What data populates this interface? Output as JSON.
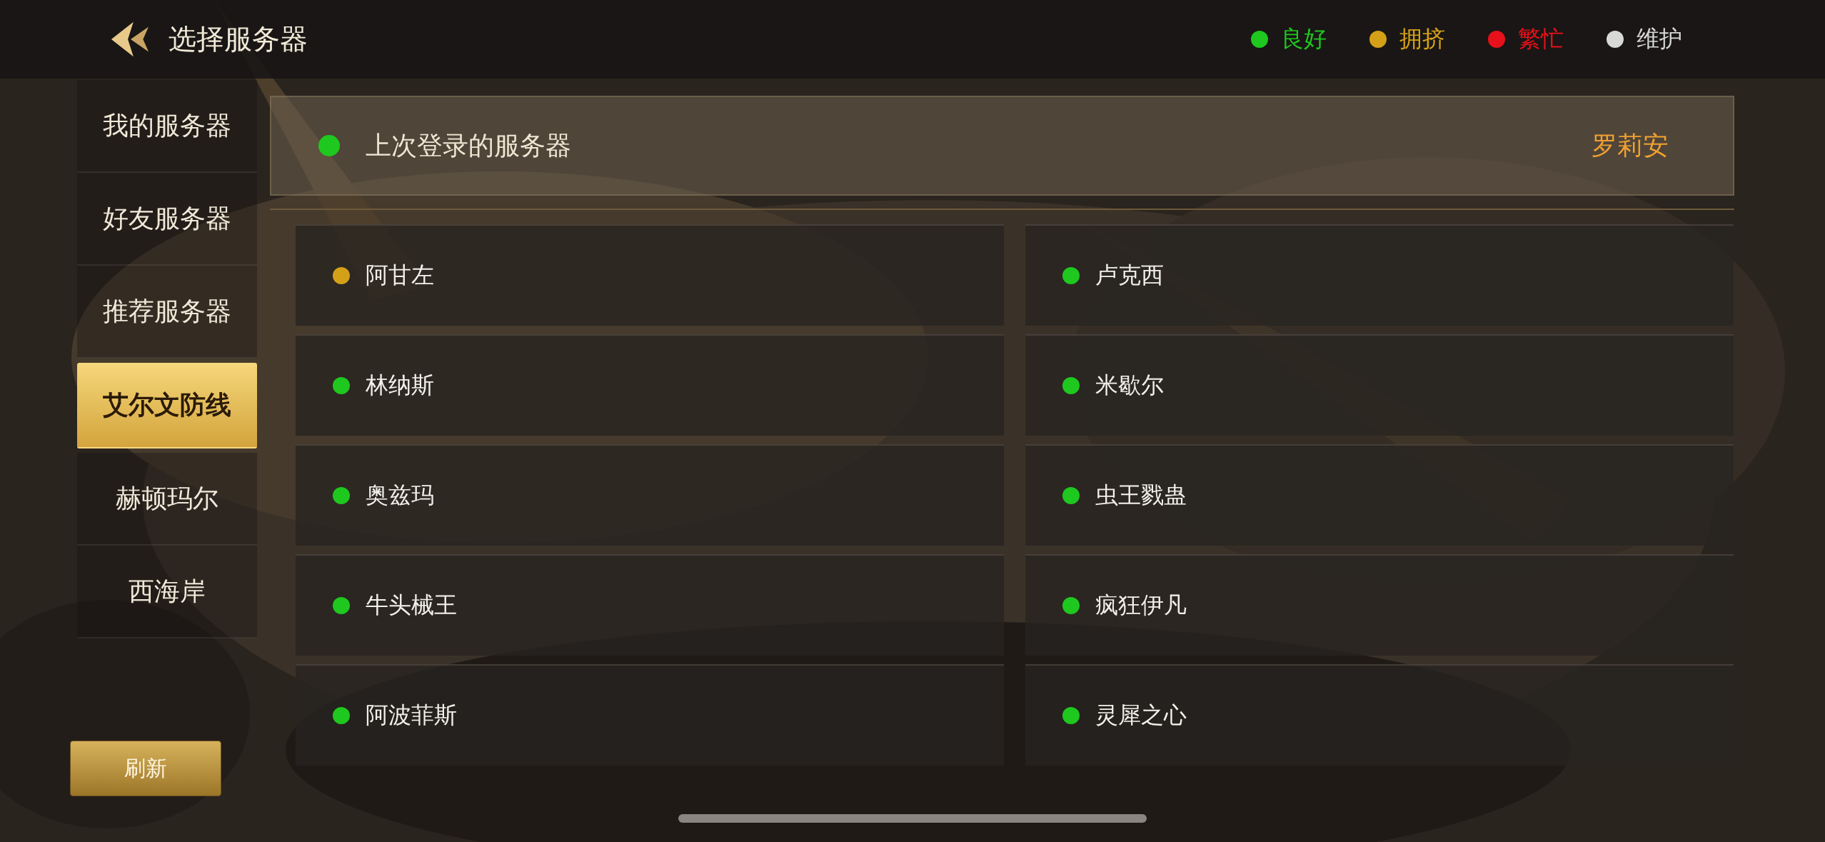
{
  "header": {
    "title": "选择服务器"
  },
  "legend": [
    {
      "label": "良好",
      "color": "#1ec81e"
    },
    {
      "label": "拥挤",
      "color": "#d4a017"
    },
    {
      "label": "繁忙",
      "color": "#e8101a"
    },
    {
      "label": "维护",
      "color": "#d8d8d8"
    }
  ],
  "sidebar": {
    "items": [
      {
        "label": "我的服务器",
        "selected": false
      },
      {
        "label": "好友服务器",
        "selected": false
      },
      {
        "label": "推荐服务器",
        "selected": false
      },
      {
        "label": "艾尔文防线",
        "selected": true
      },
      {
        "label": "赫顿玛尔",
        "selected": false
      },
      {
        "label": "西海岸",
        "selected": false
      }
    ],
    "refresh_button": "刷新"
  },
  "last_login": {
    "label": "上次登录的服务器",
    "server": "罗莉安",
    "color": "#1ec81e"
  },
  "servers": [
    {
      "name": "阿甘左",
      "color": "#d4a017"
    },
    {
      "name": "卢克西",
      "color": "#1ec81e"
    },
    {
      "name": "林纳斯",
      "color": "#1ec81e"
    },
    {
      "name": "米歇尔",
      "color": "#1ec81e"
    },
    {
      "name": "奥兹玛",
      "color": "#1ec81e"
    },
    {
      "name": "虫王戮蛊",
      "color": "#1ec81e"
    },
    {
      "name": "牛头械王",
      "color": "#1ec81e"
    },
    {
      "name": "疯狂伊凡",
      "color": "#1ec81e"
    },
    {
      "name": "阿波菲斯",
      "color": "#1ec81e"
    },
    {
      "name": "灵犀之心",
      "color": "#1ec81e"
    }
  ]
}
